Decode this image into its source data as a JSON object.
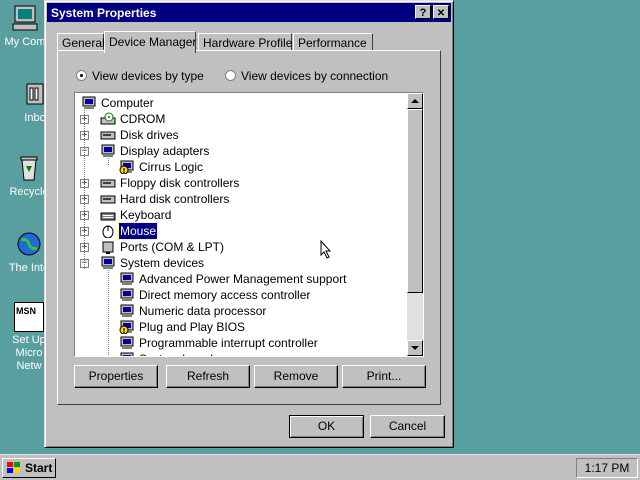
{
  "desktop": {
    "icons": [
      {
        "label": "My Com",
        "icon": "my-computer-icon"
      },
      {
        "label": "Inbo",
        "icon": "inbox-icon"
      },
      {
        "label": "Recycle",
        "icon": "recycle-bin-icon"
      },
      {
        "label": "The Inte",
        "icon": "internet-icon"
      },
      {
        "label": "Set Up",
        "label2": "Micro",
        "label3": "Netw",
        "badge": "MSN",
        "icon": "msn-icon"
      }
    ]
  },
  "window": {
    "title": "System Properties",
    "help_btn": "?",
    "close_btn": "✕",
    "tabs": [
      {
        "label": "General"
      },
      {
        "label": "Device Manager"
      },
      {
        "label": "Hardware Profiles"
      },
      {
        "label": "Performance"
      }
    ],
    "view_by_type": "View devices by type",
    "view_by_connection": "View devices by connection",
    "tree": [
      {
        "label": "Computer",
        "icon": "computer-icon"
      },
      {
        "label": "CDROM",
        "icon": "cdrom-icon",
        "pm": "+"
      },
      {
        "label": "Disk drives",
        "icon": "disk-drive-icon",
        "pm": "+"
      },
      {
        "label": "Display adapters",
        "icon": "monitor-icon",
        "pm": "−"
      },
      {
        "label": "Cirrus Logic",
        "icon": "warning-monitor-icon"
      },
      {
        "label": "Floppy disk controllers",
        "icon": "floppy-controller-icon",
        "pm": "+"
      },
      {
        "label": "Hard disk controllers",
        "icon": "hdd-controller-icon",
        "pm": "+"
      },
      {
        "label": "Keyboard",
        "icon": "keyboard-icon",
        "pm": "+"
      },
      {
        "label": "Mouse",
        "icon": "mouse-icon",
        "pm": "+"
      },
      {
        "label": "Ports (COM & LPT)",
        "icon": "port-icon",
        "pm": "+"
      },
      {
        "label": "System devices",
        "icon": "computer-icon",
        "pm": "−"
      },
      {
        "label": "Advanced Power Management support",
        "icon": "computer-icon"
      },
      {
        "label": "Direct memory access controller",
        "icon": "computer-icon"
      },
      {
        "label": "Numeric data processor",
        "icon": "computer-icon"
      },
      {
        "label": "Plug and Play BIOS",
        "icon": "warning-computer-icon"
      },
      {
        "label": "Programmable interrupt controller",
        "icon": "computer-icon"
      },
      {
        "label": "System board",
        "icon": "computer-icon"
      }
    ],
    "buttons": {
      "properties": "Properties",
      "refresh": "Refresh",
      "remove": "Remove",
      "print": "Print...",
      "ok": "OK",
      "cancel": "Cancel"
    }
  },
  "taskbar": {
    "start": "Start",
    "clock": "1:17 PM"
  },
  "colors": {
    "desktop": "#5a9fa0",
    "titlebar": "#000080",
    "selection": "#000080",
    "face": "#c0c0c0"
  }
}
